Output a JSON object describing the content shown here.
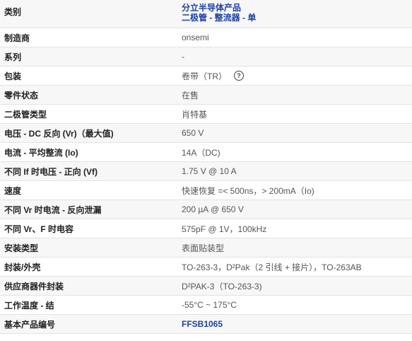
{
  "header": {
    "label": "类别",
    "category_line1": "分立半导体产品",
    "category_line2": "二极管 - 整流器 - 单"
  },
  "rows": [
    {
      "label": "制造商",
      "value": "onsemi"
    },
    {
      "label": "系列",
      "value": "-"
    },
    {
      "label": "包装",
      "value": "卷带（TR）",
      "help_icon": "question-circle-icon"
    },
    {
      "label": "零件状态",
      "value": "在售"
    },
    {
      "label": "二极管类型",
      "value": "肖特基"
    },
    {
      "label": "电压 - DC 反向 (Vr)（最大值)",
      "value": "650 V"
    },
    {
      "label": "电流 - 平均整流 (Io)",
      "value": "14A（DC)"
    },
    {
      "label": "不同 If 时电压 - 正向 (Vf)",
      "value": "1.75 V @ 10 A"
    },
    {
      "label": "速度",
      "value": "快速恢复 =< 500ns，> 200mA（Io)"
    },
    {
      "label": "不同 Vr 时电流 - 反向泄漏",
      "value": "200 µA @ 650 V"
    },
    {
      "label": "不同 Vr、F 时电容",
      "value": "575pF @ 1V，100kHz"
    },
    {
      "label": "安装类型",
      "value": "表面贴装型"
    },
    {
      "label": "封装/外壳",
      "value": "TO-263-3，D²Pak（2 引线 + 接片），TO-263AB"
    },
    {
      "label": "供应商器件封装",
      "value": "D²PAK-3（TO-263-3)"
    },
    {
      "label": "工作温度 - 结",
      "value": "-55°C ~ 175°C"
    },
    {
      "label": "基本产品编号",
      "value": "FFSB1065"
    }
  ],
  "colors": {
    "link": "#1a3fb5",
    "border": "#e3e3e3",
    "stripe": "#f7f7f7"
  }
}
